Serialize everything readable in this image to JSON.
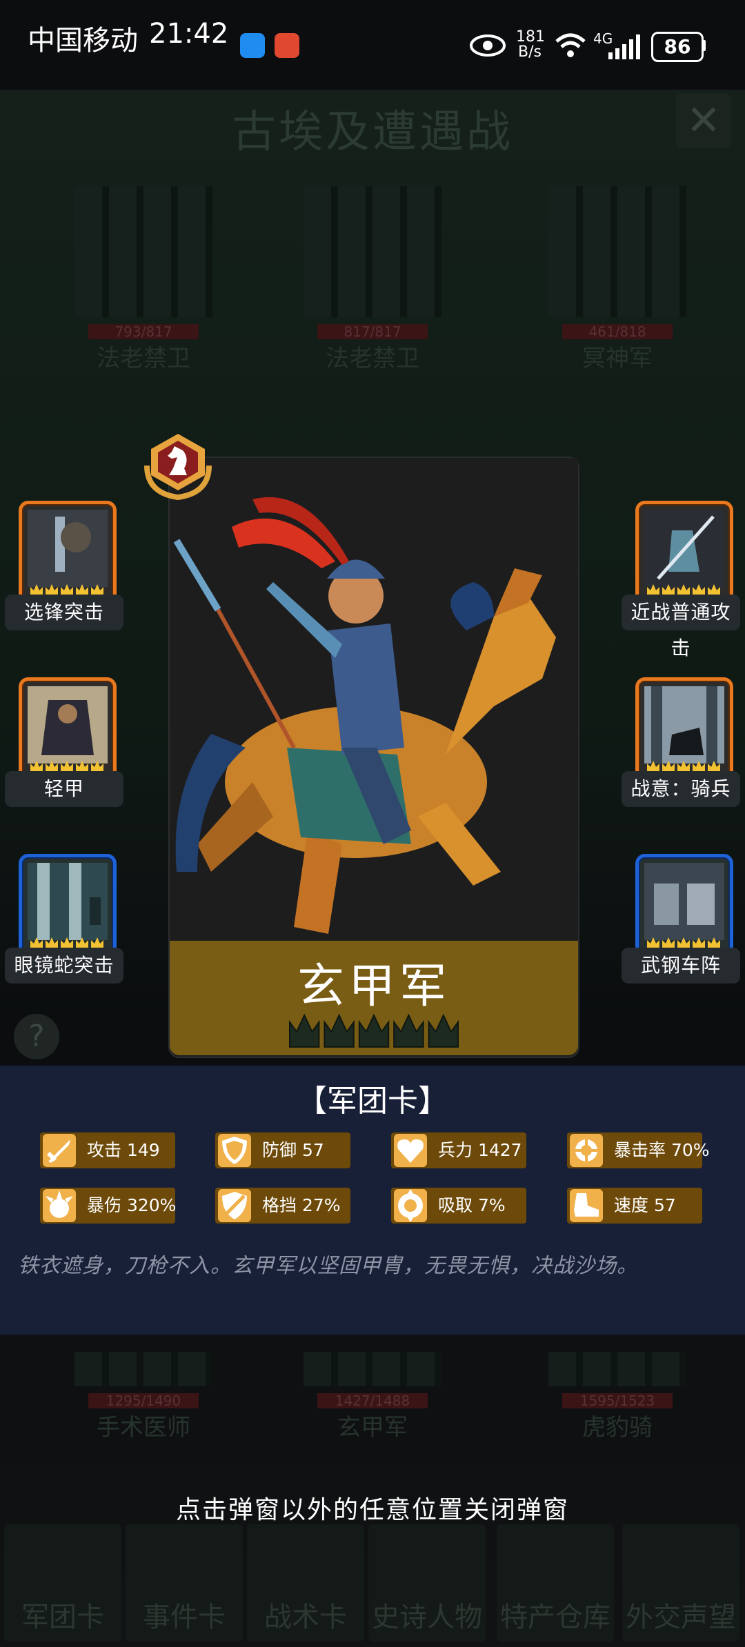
{
  "status_bar": {
    "carrier": "中国移动",
    "time": "21:42",
    "net_speed_value": "181",
    "net_speed_unit": "B/s",
    "network_type": "4G",
    "battery": "86"
  },
  "background": {
    "title": "古埃及遭遇战",
    "enemy_units": [
      {
        "hp": "793/817",
        "name": "法老禁卫"
      },
      {
        "hp": "817/817",
        "name": "法老禁卫"
      },
      {
        "hp": "461/818",
        "name": "冥神军"
      }
    ],
    "ally_units": [
      {
        "hp": "1295/1490",
        "name": "手术医师"
      },
      {
        "hp": "1427/1488",
        "name": "玄甲军"
      },
      {
        "hp": "1595/1523",
        "name": "虎豹骑"
      }
    ],
    "nav": [
      {
        "label": "军团卡"
      },
      {
        "label": "事件卡"
      },
      {
        "label": "战术卡"
      },
      {
        "label": "史诗人物"
      },
      {
        "label": "特产仓库"
      },
      {
        "label": "外交声望"
      }
    ],
    "help_glyph": "?"
  },
  "card": {
    "name": "玄甲军",
    "crown_count": 5,
    "colors": {
      "band": "#7a5d14",
      "crown": "#1d2a20",
      "horse": "#d9912e",
      "armor": "#3d5b8c",
      "plume": "#d9321f"
    }
  },
  "skills_left": [
    {
      "label": "选锋突击",
      "frame": "orange"
    },
    {
      "label": "轻甲",
      "frame": "orange"
    },
    {
      "label": "眼镜蛇突击",
      "frame": "blue"
    }
  ],
  "skills_right": [
    {
      "label": "近战普通攻击",
      "frame": "orange"
    },
    {
      "label": "战意：骑兵",
      "frame": "orange"
    },
    {
      "label": "武钢车阵",
      "frame": "blue"
    }
  ],
  "panel": {
    "title": "【军团卡】",
    "stats": [
      {
        "icon": "sword-icon",
        "label": "攻击 149"
      },
      {
        "icon": "shield-icon",
        "label": "防御 57"
      },
      {
        "icon": "heart-icon",
        "label": "兵力 1427"
      },
      {
        "icon": "crosshair-icon",
        "label": "暴击率 70%"
      },
      {
        "icon": "burst-icon",
        "label": "暴伤 320%"
      },
      {
        "icon": "block-shield-icon",
        "label": "格挡 27%"
      },
      {
        "icon": "absorb-icon",
        "label": "吸取 7%"
      },
      {
        "icon": "boot-icon",
        "label": "速度 57"
      }
    ],
    "flavor": "铁衣遮身，刀枪不入。玄甲军以坚固甲胄，无畏无惧，决战沙场。"
  },
  "hint": "点击弹窗以外的任意位置关闭弹窗"
}
